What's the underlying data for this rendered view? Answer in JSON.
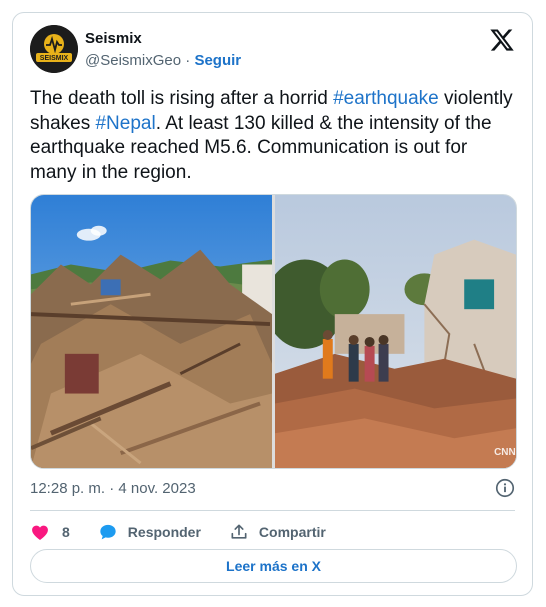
{
  "account": {
    "avatar_text": "SEISMIX",
    "display_name": "Seismix",
    "handle": "@SeismixGeo",
    "separator": " · ",
    "follow_label": "Seguir"
  },
  "post": {
    "text_1": "The death toll is rising after a horrid ",
    "hashtag_1": "#earthquake",
    "text_2": " violently shakes ",
    "hashtag_2": "#Nepal",
    "text_3": ". At least 130 killed & the intensity of the earthquake reached M5.6. Communication is out for many in the region.",
    "timestamp": "12:28 p. m. · 4 nov. 2023"
  },
  "media": {
    "image_1_watermark": "",
    "image_2_watermark": "CNN"
  },
  "actions": {
    "like_count": "8",
    "reply_label": "Responder",
    "share_label": "Compartir"
  },
  "footer": {
    "read_more_label": "Leer más en X"
  },
  "colors": {
    "link": "#1d73c9",
    "like": "#f91880",
    "reply": "#1d9bf0",
    "text": "#0f1419",
    "muted": "#536471",
    "border": "#cfd9de"
  }
}
